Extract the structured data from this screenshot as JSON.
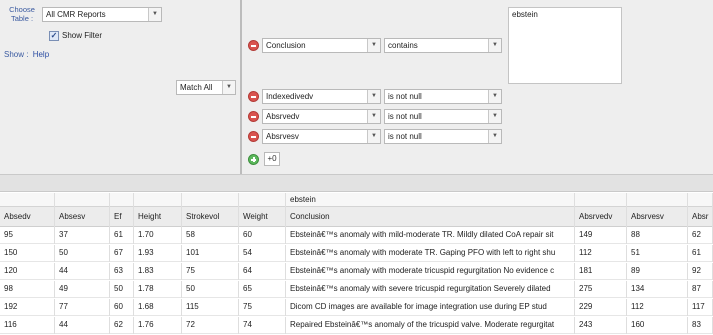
{
  "filter_panel": {
    "choose_table_label": "Choose Table :",
    "table_select_value": "All CMR Reports",
    "show_filter_label": "Show Filter",
    "show_filter_checked": true,
    "show_label": "Show :",
    "help_link": "Help",
    "match_select_value": "Match All",
    "conditions": [
      {
        "field": "Conclusion",
        "operator": "contains"
      },
      {
        "field": "Indexedivedv",
        "operator": "is not null"
      },
      {
        "field": "Absrvedv",
        "operator": "is not null"
      },
      {
        "field": "Absrvesv",
        "operator": "is not null"
      }
    ],
    "value_text": "ebstein",
    "add_value": "+0"
  },
  "table": {
    "filter_row": {
      "conclusion": "ebstein"
    },
    "columns": [
      "Absedv",
      "Absesv",
      "Ef",
      "Height",
      "Strokevol",
      "Weight",
      "Conclusion",
      "Absrvedv",
      "Absrvesv",
      "Absr"
    ],
    "rows": [
      [
        "95",
        "37",
        "61",
        "1.70",
        "58",
        "60",
        "Ebsteinâ€™s anomaly with mild-moderate TR. Mildly dilated CoA repair sit",
        "149",
        "88",
        "62"
      ],
      [
        "150",
        "50",
        "67",
        "1.93",
        "101",
        "54",
        "Ebsteinâ€™s anomaly with moderate TR. Gaping PFO with left to right shu",
        "112",
        "51",
        "61"
      ],
      [
        "120",
        "44",
        "63",
        "1.83",
        "75",
        "64",
        "Ebsteinâ€™s anomaly with moderate tricuspid regurgitation No evidence c",
        "181",
        "89",
        "92"
      ],
      [
        "98",
        "49",
        "50",
        "1.78",
        "50",
        "65",
        "Ebsteinâ€™s anomaly with severe tricuspid regurgitation Severely dilated",
        "275",
        "134",
        "87"
      ],
      [
        "192",
        "77",
        "60",
        "1.68",
        "115",
        "75",
        "Dicom CD images are available for image integration use during EP stud",
        "229",
        "112",
        "117"
      ],
      [
        "116",
        "44",
        "62",
        "1.76",
        "72",
        "74",
        "Repaired Ebsteinâ€™s anomaly of the tricuspid valve. Moderate regurgitat",
        "243",
        "160",
        "83"
      ]
    ]
  }
}
